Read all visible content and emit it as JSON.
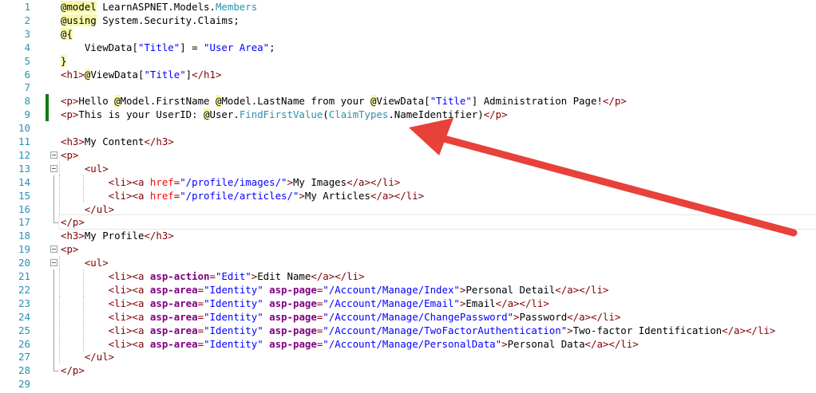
{
  "editor": {
    "colors": {
      "line_number": "#2b91af",
      "tag": "#800000",
      "html_attribute": "#ff0000",
      "string": "#0000ff",
      "type": "#2b91af",
      "tag_helper_attribute": "#800080",
      "razor_highlight": "#f8f8a8",
      "change_marker": "#107c10",
      "annotation_arrow": "#e8413a"
    },
    "lines": [
      {
        "n": "1",
        "tokens": [
          [
            "razor",
            "@model"
          ],
          [
            "text",
            " LearnASPNET.Models."
          ],
          [
            "type",
            "Members"
          ]
        ]
      },
      {
        "n": "2",
        "tokens": [
          [
            "razor",
            "@using"
          ],
          [
            "text",
            " System.Security.Claims;"
          ]
        ]
      },
      {
        "n": "3",
        "tokens": [
          [
            "razor",
            "@{"
          ]
        ]
      },
      {
        "n": "4",
        "tokens": [
          [
            "text",
            "    ViewData["
          ],
          [
            "str",
            "\"Title\""
          ],
          [
            "text",
            "] = "
          ],
          [
            "str",
            "\"User Area\""
          ],
          [
            "text",
            ";"
          ]
        ]
      },
      {
        "n": "5",
        "tokens": [
          [
            "razor",
            "}"
          ]
        ]
      },
      {
        "n": "6",
        "tokens": [
          [
            "tag",
            "<h1>"
          ],
          [
            "razor",
            "@"
          ],
          [
            "text",
            "ViewData["
          ],
          [
            "str",
            "\"Title\""
          ],
          [
            "text",
            "]"
          ],
          [
            "tag",
            "</h1>"
          ]
        ]
      },
      {
        "n": "7",
        "tokens": []
      },
      {
        "n": "8",
        "tokens": [
          [
            "tag",
            "<p>"
          ],
          [
            "text",
            "Hello "
          ],
          [
            "razor",
            "@"
          ],
          [
            "text",
            "Model.FirstName "
          ],
          [
            "razor",
            "@"
          ],
          [
            "text",
            "Model.LastName from your "
          ],
          [
            "razor",
            "@"
          ],
          [
            "text",
            "ViewData["
          ],
          [
            "str",
            "\"Title\""
          ],
          [
            "text",
            "] Administration Page!"
          ],
          [
            "tag",
            "</p>"
          ]
        ]
      },
      {
        "n": "9",
        "tokens": [
          [
            "tag",
            "<p>"
          ],
          [
            "text",
            "This is your UserID: "
          ],
          [
            "razor",
            "@"
          ],
          [
            "text",
            "User."
          ],
          [
            "type",
            "FindFirstValue"
          ],
          [
            "text",
            "("
          ],
          [
            "type",
            "ClaimTypes"
          ],
          [
            "text",
            ".NameIdentifier)"
          ],
          [
            "tag",
            "</p>"
          ]
        ]
      },
      {
        "n": "10",
        "tokens": []
      },
      {
        "n": "11",
        "tokens": [
          [
            "tag",
            "<h3>"
          ],
          [
            "text",
            "My Content"
          ],
          [
            "tag",
            "</h3>"
          ]
        ]
      },
      {
        "n": "12",
        "tokens": [
          [
            "tag",
            "<p>"
          ]
        ]
      },
      {
        "n": "13",
        "tokens": [
          [
            "text",
            "    "
          ],
          [
            "tag",
            "<ul>"
          ]
        ]
      },
      {
        "n": "14",
        "tokens": [
          [
            "text",
            "        "
          ],
          [
            "tag",
            "<li><a "
          ],
          [
            "attr",
            "href"
          ],
          [
            "tag",
            "="
          ],
          [
            "str",
            "\"/profile/images/\""
          ],
          [
            "tag",
            ">"
          ],
          [
            "text",
            "My Images"
          ],
          [
            "tag",
            "</a></li>"
          ]
        ]
      },
      {
        "n": "15",
        "tokens": [
          [
            "text",
            "        "
          ],
          [
            "tag",
            "<li><a "
          ],
          [
            "attr",
            "href"
          ],
          [
            "tag",
            "="
          ],
          [
            "str",
            "\"/profile/articles/\""
          ],
          [
            "tag",
            ">"
          ],
          [
            "text",
            "My Articles"
          ],
          [
            "tag",
            "</a></li>"
          ]
        ]
      },
      {
        "n": "16",
        "tokens": [
          [
            "text",
            "    "
          ],
          [
            "tag",
            "</ul>"
          ]
        ]
      },
      {
        "n": "17",
        "tokens": [
          [
            "tag",
            "</p>"
          ]
        ]
      },
      {
        "n": "18",
        "tokens": [
          [
            "tag",
            "<h3>"
          ],
          [
            "text",
            "My Profile"
          ],
          [
            "tag",
            "</h3>"
          ]
        ]
      },
      {
        "n": "19",
        "tokens": [
          [
            "tag",
            "<p>"
          ]
        ]
      },
      {
        "n": "20",
        "tokens": [
          [
            "text",
            "    "
          ],
          [
            "tag",
            "<ul>"
          ]
        ]
      },
      {
        "n": "21",
        "tokens": [
          [
            "text",
            "        "
          ],
          [
            "tag",
            "<li><a "
          ],
          [
            "tagattr",
            "asp-action"
          ],
          [
            "tag",
            "="
          ],
          [
            "str",
            "\"Edit\""
          ],
          [
            "tag",
            ">"
          ],
          [
            "text",
            "Edit Name"
          ],
          [
            "tag",
            "</a></li>"
          ]
        ]
      },
      {
        "n": "22",
        "tokens": [
          [
            "text",
            "        "
          ],
          [
            "tag",
            "<li><a "
          ],
          [
            "tagattr",
            "asp-area"
          ],
          [
            "tag",
            "="
          ],
          [
            "str",
            "\"Identity\""
          ],
          [
            "text",
            " "
          ],
          [
            "tagattr",
            "asp-page"
          ],
          [
            "tag",
            "="
          ],
          [
            "str",
            "\"/Account/Manage/Index\""
          ],
          [
            "tag",
            ">"
          ],
          [
            "text",
            "Personal Detail"
          ],
          [
            "tag",
            "</a></li>"
          ]
        ]
      },
      {
        "n": "23",
        "tokens": [
          [
            "text",
            "        "
          ],
          [
            "tag",
            "<li><a "
          ],
          [
            "tagattr",
            "asp-area"
          ],
          [
            "tag",
            "="
          ],
          [
            "str",
            "\"Identity\""
          ],
          [
            "text",
            " "
          ],
          [
            "tagattr",
            "asp-page"
          ],
          [
            "tag",
            "="
          ],
          [
            "str",
            "\"/Account/Manage/Email\""
          ],
          [
            "tag",
            ">"
          ],
          [
            "text",
            "Email"
          ],
          [
            "tag",
            "</a></li>"
          ]
        ]
      },
      {
        "n": "24",
        "tokens": [
          [
            "text",
            "        "
          ],
          [
            "tag",
            "<li><a "
          ],
          [
            "tagattr",
            "asp-area"
          ],
          [
            "tag",
            "="
          ],
          [
            "str",
            "\"Identity\""
          ],
          [
            "text",
            " "
          ],
          [
            "tagattr",
            "asp-page"
          ],
          [
            "tag",
            "="
          ],
          [
            "str",
            "\"/Account/Manage/ChangePassword\""
          ],
          [
            "tag",
            ">"
          ],
          [
            "text",
            "Password"
          ],
          [
            "tag",
            "</a></li>"
          ]
        ]
      },
      {
        "n": "25",
        "tokens": [
          [
            "text",
            "        "
          ],
          [
            "tag",
            "<li><a "
          ],
          [
            "tagattr",
            "asp-area"
          ],
          [
            "tag",
            "="
          ],
          [
            "str",
            "\"Identity\""
          ],
          [
            "text",
            " "
          ],
          [
            "tagattr",
            "asp-page"
          ],
          [
            "tag",
            "="
          ],
          [
            "str",
            "\"/Account/Manage/TwoFactorAuthentication\""
          ],
          [
            "tag",
            ">"
          ],
          [
            "text",
            "Two-factor Identification"
          ],
          [
            "tag",
            "</a></li>"
          ]
        ]
      },
      {
        "n": "26",
        "tokens": [
          [
            "text",
            "        "
          ],
          [
            "tag",
            "<li><a "
          ],
          [
            "tagattr",
            "asp-area"
          ],
          [
            "tag",
            "="
          ],
          [
            "str",
            "\"Identity\""
          ],
          [
            "text",
            " "
          ],
          [
            "tagattr",
            "asp-page"
          ],
          [
            "tag",
            "="
          ],
          [
            "str",
            "\"/Account/Manage/PersonalData\""
          ],
          [
            "tag",
            ">"
          ],
          [
            "text",
            "Personal Data"
          ],
          [
            "tag",
            "</a></li>"
          ]
        ]
      },
      {
        "n": "27",
        "tokens": [
          [
            "text",
            "    "
          ],
          [
            "tag",
            "</ul>"
          ]
        ]
      },
      {
        "n": "28",
        "tokens": [
          [
            "tag",
            "</p>"
          ]
        ]
      },
      {
        "n": "29",
        "tokens": []
      }
    ],
    "changed_lines": [
      "8",
      "9"
    ],
    "current_line": "17",
    "fold_open_lines": [
      "12",
      "13",
      "19",
      "20"
    ],
    "icons": {
      "fold": "collapse-icon",
      "annotation": "arrow-icon"
    }
  }
}
